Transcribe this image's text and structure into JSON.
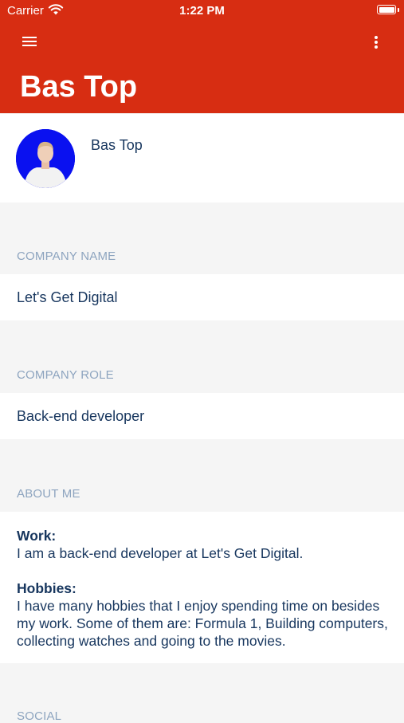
{
  "status": {
    "carrier": "Carrier",
    "time": "1:22 PM"
  },
  "appbar": {
    "title": "Bas Top",
    "menu_icon": "hamburger-menu-icon",
    "more_icon": "more-vertical-icon",
    "color": "#d72d12"
  },
  "profile": {
    "name": "Bas Top",
    "avatar_bg": "#0a11f0"
  },
  "company_name": {
    "label": "COMPANY NAME",
    "value": "Let's Get Digital"
  },
  "company_role": {
    "label": "COMPANY ROLE",
    "value": "Back-end developer"
  },
  "about": {
    "label": "ABOUT ME",
    "work_heading": "Work:",
    "work_text": "I am a back-end developer at Let's Get Digital.",
    "hobbies_heading": "Hobbies:",
    "hobbies_text": "I have many hobbies that I enjoy spending time on besides my work. Some of them are: Formula 1, Building computers, collecting watches and going to the movies."
  },
  "social": {
    "label": "SOCIAL"
  }
}
